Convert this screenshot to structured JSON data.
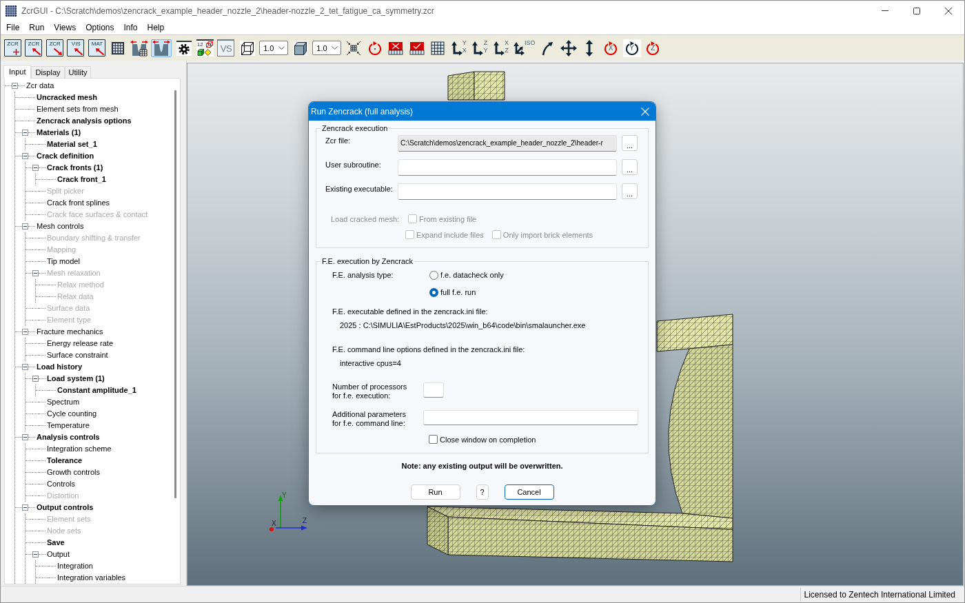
{
  "window": {
    "title": "ZcrGUI - C:\\Scratch\\demos\\zencrack_example_header_nozzle_2\\header-nozzle_2_tet_fatigue_ca_symmetry.zcr"
  },
  "menu": [
    "File",
    "Run",
    "Views",
    "Options",
    "Info",
    "Help"
  ],
  "toolbar": [
    {
      "kind": "file-new",
      "text": "ZCR"
    },
    {
      "kind": "file-open",
      "text": "ZCR"
    },
    {
      "kind": "file-save",
      "text": "ZCR"
    },
    {
      "kind": "file-open",
      "text": "VIS"
    },
    {
      "kind": "file-open",
      "text": "MAT"
    },
    {
      "kind": "mesh-grid"
    },
    {
      "kind": "nozzle-mesh",
      "pressed": false
    },
    {
      "kind": "nozzle",
      "pressed": true
    },
    {
      "kind": "gear"
    },
    {
      "kind": "numbering",
      "text": "12"
    },
    {
      "kind": "text-tile",
      "text": "VS"
    },
    {
      "kind": "wire-cube"
    },
    {
      "kind": "dropdown",
      "value": "1.0"
    },
    {
      "kind": "solid-cube"
    },
    {
      "kind": "dropdown",
      "value": "1.0"
    },
    {
      "kind": "fit"
    },
    {
      "kind": "rotate-free"
    },
    {
      "kind": "grid-cross"
    },
    {
      "kind": "grid-check"
    },
    {
      "kind": "grid"
    },
    {
      "kind": "axes",
      "text": "Y",
      "text_2": "X"
    },
    {
      "kind": "axes",
      "text": "Z",
      "text_2": "Y"
    },
    {
      "kind": "axes",
      "text": "X",
      "text_2": "Z"
    },
    {
      "kind": "axes-iso",
      "text": "ISO"
    },
    {
      "kind": "curve-arrow"
    },
    {
      "kind": "move"
    },
    {
      "kind": "up-down"
    },
    {
      "kind": "rotate-axis",
      "text": "X",
      "pressed": false
    },
    {
      "kind": "rotate-axis",
      "text": "Y",
      "pressed": true
    },
    {
      "kind": "rotate-axis",
      "text": "Z",
      "pressed": false
    }
  ],
  "side_panel": {
    "tabs": [
      {
        "label": "Input",
        "selected": true
      },
      {
        "label": "Display",
        "selected": false
      },
      {
        "label": "Utility",
        "selected": false
      }
    ],
    "tree": [
      {
        "label": "Zcr data",
        "defined": false,
        "disabled": false,
        "expanded": true,
        "children": [
          {
            "label": "Uncracked mesh",
            "defined": true,
            "disabled": false
          },
          {
            "label": "Element sets from mesh",
            "defined": false,
            "disabled": false
          },
          {
            "label": "Zencrack analysis options",
            "defined": true,
            "disabled": false
          },
          {
            "label": "Materials (1)",
            "defined": true,
            "disabled": false,
            "expanded": true,
            "children": [
              {
                "label": "Material set_1",
                "defined": true,
                "disabled": false
              }
            ]
          },
          {
            "label": "Crack definition",
            "defined": true,
            "disabled": false,
            "expanded": true,
            "children": [
              {
                "label": "Crack fronts (1)",
                "defined": true,
                "disabled": false,
                "expanded": true,
                "children": [
                  {
                    "label": "Crack front_1",
                    "defined": true,
                    "disabled": false
                  }
                ]
              },
              {
                "label": "Split picker",
                "defined": false,
                "disabled": true
              },
              {
                "label": "Crack front splines",
                "defined": false,
                "disabled": false
              },
              {
                "label": "Crack face surfaces & contact",
                "defined": false,
                "disabled": true
              }
            ]
          },
          {
            "label": "Mesh controls",
            "defined": false,
            "disabled": false,
            "expanded": true,
            "children": [
              {
                "label": "Boundary shifting & transfer",
                "defined": false,
                "disabled": true
              },
              {
                "label": "Mapping",
                "defined": false,
                "disabled": true
              },
              {
                "label": "Tip model",
                "defined": false,
                "disabled": false
              },
              {
                "label": "Mesh relaxation",
                "defined": false,
                "disabled": true,
                "expanded": true,
                "children": [
                  {
                    "label": "Relax method",
                    "defined": false,
                    "disabled": true
                  },
                  {
                    "label": "Relax data",
                    "defined": false,
                    "disabled": true
                  }
                ]
              },
              {
                "label": "Surface data",
                "defined": false,
                "disabled": true
              },
              {
                "label": "Element type",
                "defined": false,
                "disabled": true
              }
            ]
          },
          {
            "label": "Fracture mechanics",
            "defined": false,
            "disabled": false,
            "expanded": true,
            "children": [
              {
                "label": "Energy release rate",
                "defined": false,
                "disabled": false
              },
              {
                "label": "Surface constraint",
                "defined": false,
                "disabled": false
              }
            ]
          },
          {
            "label": "Load history",
            "defined": true,
            "disabled": false,
            "expanded": true,
            "children": [
              {
                "label": "Load system (1)",
                "defined": true,
                "disabled": false,
                "expanded": true,
                "children": [
                  {
                    "label": "Constant amplitude_1",
                    "defined": true,
                    "disabled": false
                  }
                ]
              },
              {
                "label": "Spectrum",
                "defined": false,
                "disabled": false
              },
              {
                "label": "Cycle counting",
                "defined": false,
                "disabled": false
              },
              {
                "label": "Temperature",
                "defined": false,
                "disabled": false
              }
            ]
          },
          {
            "label": "Analysis controls",
            "defined": true,
            "disabled": false,
            "expanded": true,
            "children": [
              {
                "label": "Integration scheme",
                "defined": false,
                "disabled": false
              },
              {
                "label": "Tolerance",
                "defined": true,
                "disabled": false
              },
              {
                "label": "Growth controls",
                "defined": false,
                "disabled": false
              },
              {
                "label": "Controls",
                "defined": false,
                "disabled": false
              },
              {
                "label": "Distortion",
                "defined": false,
                "disabled": true
              }
            ]
          },
          {
            "label": "Output controls",
            "defined": true,
            "disabled": false,
            "expanded": true,
            "children": [
              {
                "label": "Element sets",
                "defined": false,
                "disabled": true
              },
              {
                "label": "Node sets",
                "defined": false,
                "disabled": true
              },
              {
                "label": "Save",
                "defined": true,
                "disabled": false
              },
              {
                "label": "Output",
                "defined": false,
                "disabled": false,
                "expanded": true,
                "children": [
                  {
                    "label": "Integration",
                    "defined": false,
                    "disabled": false
                  },
                  {
                    "label": "Integration variables",
                    "defined": false,
                    "disabled": false
                  }
                ]
              }
            ]
          }
        ]
      }
    ]
  },
  "viewport": {
    "axes": {
      "y": "Y",
      "x": "X",
      "z": "Z"
    }
  },
  "dialog": {
    "title": "Run Zencrack (full analysis)",
    "zencrack_execution": {
      "title": "Zencrack execution",
      "fields": [
        {
          "label": "Zcr file:",
          "value": "C:\\Scratch\\demos\\zencrack_example_header_nozzle_2\\header-r",
          "readonly": true,
          "browse": "..."
        },
        {
          "label": "User subroutine:",
          "readonly": false,
          "browse": "..."
        },
        {
          "label": "Existing executable:",
          "readonly": false,
          "browse": "..."
        }
      ],
      "load_cracked_mesh": {
        "label": "Load cracked mesh:",
        "disabled": true,
        "options": [
          {
            "label": "From existing file",
            "checked": false
          },
          {
            "label": "Expand include files",
            "checked": false
          },
          {
            "label": "Only import brick elements",
            "checked": false
          }
        ]
      }
    },
    "fe_execution": {
      "title": "F.E. execution by Zencrack",
      "analysis_type": {
        "label": "F.E. analysis type:",
        "options": [
          {
            "label": "f.e. datacheck only",
            "selected": false
          },
          {
            "label": "full f.e. run",
            "selected": true
          }
        ]
      },
      "executable": {
        "label": "F.E. executable defined in the zencrack.ini file:",
        "value": "2025 : C:\\SIMULIA\\EstProducts\\2025\\win_b64\\code\\bin\\smalauncher.exe"
      },
      "command_options": {
        "label": "F.E. command line options defined in the zencrack.ini file:",
        "value": "interactive cpus=4"
      },
      "processors": {
        "label": "Number of processors\nfor f.e. execution:"
      },
      "additional_parameters": {
        "label": "Additional parameters\nfor f.e. command line:"
      },
      "close_on_completion": {
        "label": "Close window on completion",
        "checked": false
      }
    },
    "note": "Note: any existing output will be overwritten.",
    "buttons": [
      {
        "label": "Run",
        "default": false
      },
      {
        "label": "?",
        "default": false
      },
      {
        "label": "Cancel",
        "default": true
      }
    ]
  },
  "status_bar": {
    "text": "Licensed to Zentech International Limited"
  }
}
